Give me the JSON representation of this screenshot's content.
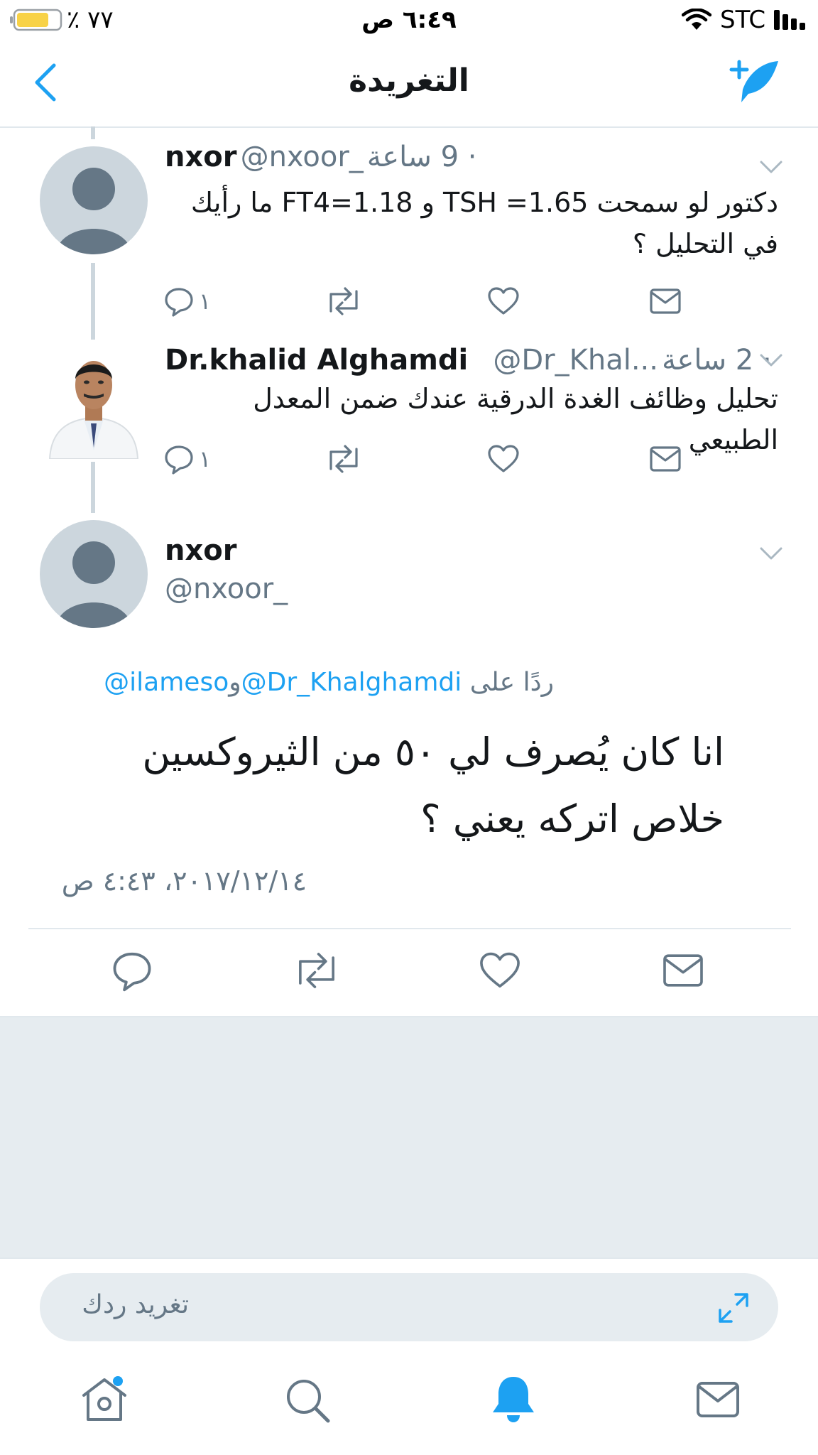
{
  "status_bar": {
    "battery_percent": "٪ ٧٧",
    "time": "٦:٤٩ ص",
    "carrier": "STC"
  },
  "header": {
    "title": "التغريدة"
  },
  "tweets": [
    {
      "name": "nxor",
      "handle": "@nxoor_",
      "time": "· 9 ساعة",
      "text": "دكتور لو سمحت TSH =1.65 و FT4=1.18  ما رأيك في التحليل ؟",
      "reply_count": "١",
      "avatar": "default-avatar"
    },
    {
      "name": "Dr.khalid Alghamdi",
      "handle": "@Dr_Khal...",
      "time": "· 2 ساعة",
      "text": "تحليل وظائف الغدة الدرقية عندك ضمن المعدل الطبيعي",
      "reply_count": "١",
      "avatar": "doctor-photo"
    }
  ],
  "main_tweet": {
    "name": "nxor",
    "handle": "@nxoor_",
    "reply_to_prefix": "ردًا على",
    "reply_to_user1": "@Dr_Khalghamdi",
    "reply_to_and": "و",
    "reply_to_user2": "@ilameso",
    "text": "انا كان يُصرف لي ٥٠ من الثيروكسين خلاص اتركه يعني ؟",
    "timestamp": "٢٠١٧/١٢/١٤، ٤:٤٣ ص"
  },
  "reply_box": {
    "placeholder": "تغريد ردك"
  },
  "colors": {
    "accent": "#1da1f2",
    "gray_text": "#657786",
    "divider": "#e1e8ed",
    "background_gray": "#e6ecf0",
    "battery": "#f8d247"
  },
  "icons": {
    "back": "chevron-left-icon",
    "compose": "feather-plus-icon",
    "reply": "speech-bubble-icon",
    "retweet": "retweet-icon",
    "like": "heart-icon",
    "dm": "envelope-icon",
    "expand": "expand-arrows-icon",
    "home": "home-icon",
    "search": "search-icon",
    "notifications": "bell-icon",
    "messages": "envelope-icon"
  }
}
